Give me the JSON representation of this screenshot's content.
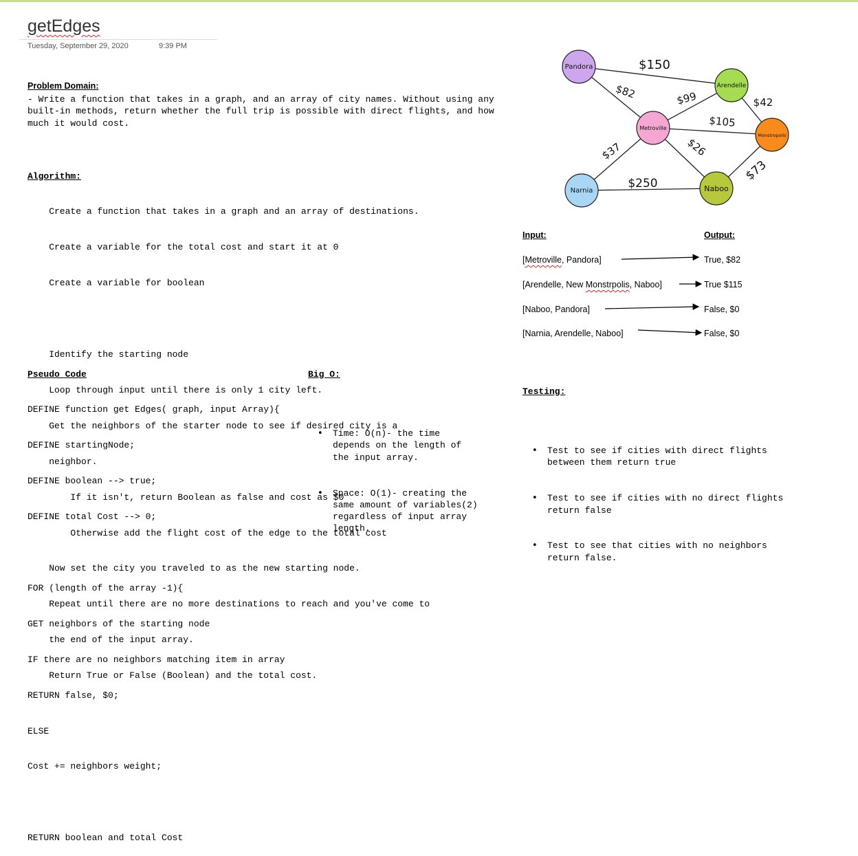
{
  "page": {
    "title": "getEdges",
    "date": "Tuesday, September 29, 2020",
    "time": "9:39 PM"
  },
  "problem": {
    "heading": "Problem Domain:",
    "text": "- Write a function that takes in a graph, and an array of city names. Without using any built-in methods, return whether the full trip is possible with direct flights, and how much it would cost."
  },
  "algorithm": {
    "heading": "Algorithm:",
    "lines": [
      "    Create a function that takes in a graph and an array of destinations.",
      "    Create a variable for the total cost and start it at 0",
      "    Create a variable for boolean",
      "",
      "    Identify the starting node",
      "    Loop through input until there is only 1 city left.",
      "    Get the neighbors of the starter node to see if desired city is a",
      "    neighbor.",
      "        If it isn't, return Boolean as false and cost as $0",
      "        Otherwise add the flight cost of the edge to the total cost",
      "    Now set the city you traveled to as the new starting node.",
      "    Repeat until there are no more destinations to reach and you've come to",
      "    the end of the input array.",
      "    Return True or False (Boolean) and the total cost."
    ]
  },
  "pseudo": {
    "heading": "Pseudo Code",
    "lines": [
      "DEFINE function get Edges( graph, input Array){",
      "DEFINE startingNode;",
      "DEFINE boolean --> true;",
      "DEFINE total Cost --> 0;",
      "",
      "FOR (length of the array -1){",
      "GET neighbors of the starting node",
      "IF there are no neighbors matching item in array",
      "RETURN false, $0;",
      "ELSE",
      "Cost += neighbors weight;",
      "",
      "RETURN boolean and total Cost"
    ]
  },
  "bigo": {
    "heading": "Big O:",
    "items": [
      "Time: O(n)- the time\ndepends on the length of\nthe input array.",
      "Space: O(1)- creating the\nsame amount of variables(2)\nregardless of input array\nlength."
    ]
  },
  "io": {
    "input_heading": "Input:",
    "output_heading": "Output:",
    "rows": [
      {
        "in_pre": "[",
        "in_sq": "Metroville",
        "in_post": ", Pandora]",
        "out": "True, $82"
      },
      {
        "in_pre": "[Arendelle, New ",
        "in_sq": "Monstrpolis",
        "in_post": ", Naboo]",
        "out": "True $115"
      },
      {
        "in_pre": "[Naboo, Pandora]",
        "in_sq": "",
        "in_post": "",
        "out": "False, $0"
      },
      {
        "in_pre": "[Narnia, Arendelle, Naboo]",
        "in_sq": "",
        "in_post": "",
        "out": "False, $0"
      }
    ]
  },
  "testing": {
    "heading": "Testing:",
    "items": [
      "Test to see if cities with direct flights\nbetween them return true",
      "Test to see if cities with no direct flights\nreturn false",
      "Test to see that cities with no neighbors\nreturn false."
    ]
  },
  "graph": {
    "nodes": [
      {
        "id": "pandora",
        "label": "Pandora",
        "color": "#cda6ee"
      },
      {
        "id": "arendelle",
        "label": "Arendelle",
        "color": "#a6dc52"
      },
      {
        "id": "metroville",
        "label": "Metroville",
        "color": "#f6a6d2"
      },
      {
        "id": "monstropolis",
        "label": "Monstropolis",
        "color": "#fb8a1c"
      },
      {
        "id": "narnia",
        "label": "Narnia",
        "color": "#a9d6f4"
      },
      {
        "id": "naboo",
        "label": "Naboo",
        "color": "#b8c83c"
      }
    ],
    "edge_labels": [
      "$150",
      "$82",
      "$99",
      "$42",
      "$105",
      "$37",
      "$26",
      "$250",
      "$73"
    ]
  }
}
